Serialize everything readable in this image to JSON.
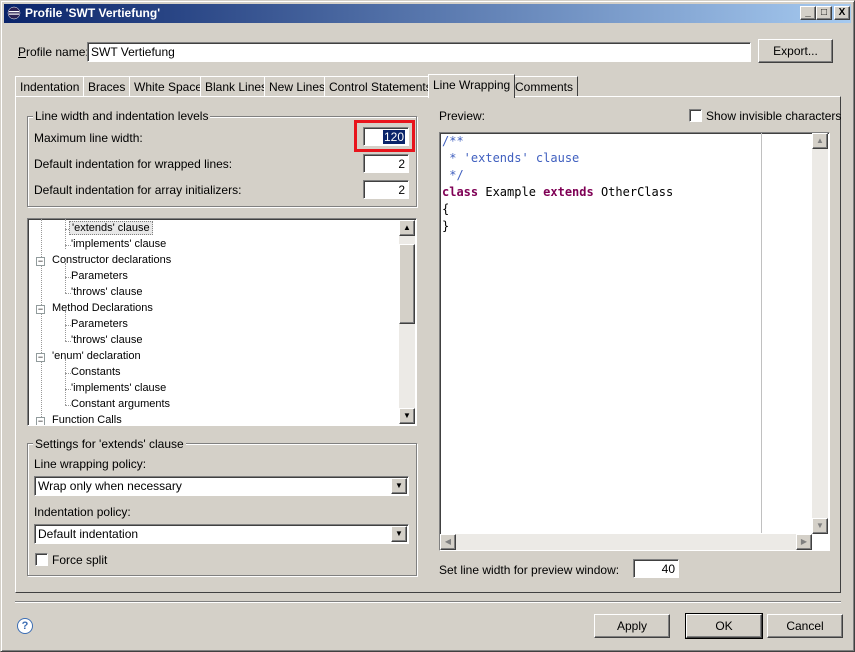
{
  "window": {
    "title": "Profile 'SWT Vertiefung'",
    "controls": {
      "minimize": "_",
      "maximize": "□",
      "close": "X"
    }
  },
  "profile": {
    "name_label": "Profile name:",
    "name_value": "SWT Vertiefung",
    "export_label": "Export..."
  },
  "tabs": [
    {
      "label": "Indentation"
    },
    {
      "label": "Braces"
    },
    {
      "label": "White Space"
    },
    {
      "label": "Blank Lines"
    },
    {
      "label": "New Lines"
    },
    {
      "label": "Control Statements"
    },
    {
      "label": "Line Wrapping"
    },
    {
      "label": "Comments"
    }
  ],
  "active_tab": "Line Wrapping",
  "line_width_group": {
    "title": "Line width and indentation levels",
    "max_width_label": "Maximum line width:",
    "max_width_value": "120",
    "wrapped_indent_label": "Default indentation for wrapped lines:",
    "wrapped_indent_value": "2",
    "array_indent_label": "Default indentation for array initializers:",
    "array_indent_value": "2"
  },
  "tree": {
    "items": [
      {
        "label": "'extends' clause",
        "selected": true
      },
      {
        "label": "'implements' clause"
      },
      {
        "label": "Constructor declarations",
        "expander": "−"
      },
      {
        "label": "Parameters"
      },
      {
        "label": "'throws' clause"
      },
      {
        "label": "Method Declarations",
        "expander": "−"
      },
      {
        "label": "Parameters"
      },
      {
        "label": "'throws' clause"
      },
      {
        "label": "'enum' declaration",
        "expander": "−"
      },
      {
        "label": "Constants"
      },
      {
        "label": "'implements' clause"
      },
      {
        "label": "Constant arguments"
      },
      {
        "label": "Function Calls",
        "expander": "−"
      }
    ]
  },
  "settings_group": {
    "title": "Settings for 'extends' clause",
    "wrap_policy_label": "Line wrapping policy:",
    "wrap_policy_value": "Wrap only when necessary",
    "indent_policy_label": "Indentation policy:",
    "indent_policy_value": "Default indentation",
    "force_split_label": "Force split",
    "force_split_checked": false
  },
  "preview": {
    "label": "Preview:",
    "show_invisible_label": "Show invisible characters",
    "show_invisible_checked": false,
    "code": {
      "l1": "/**",
      "l2": " * 'extends' clause",
      "l3": " */",
      "l4_kw1": "class",
      "l4_mid": " Example ",
      "l4_kw2": "extends",
      "l4_end": " OtherClass",
      "l5": "{",
      "l6": "}"
    },
    "preview_width_label": "Set line width for preview window:",
    "preview_width_value": "40"
  },
  "footer": {
    "help_icon": "?",
    "apply_label": "Apply",
    "ok_label": "OK",
    "cancel_label": "Cancel"
  },
  "colors": {
    "highlight": "#e8141c",
    "comment": "#3f5fbf",
    "keyword": "#7f0055"
  },
  "icons": {
    "app": "eclipse-icon",
    "scroll_up": "▲",
    "scroll_down": "▼",
    "scroll_left": "◀",
    "scroll_right": "▶",
    "dropdown": "▼"
  }
}
